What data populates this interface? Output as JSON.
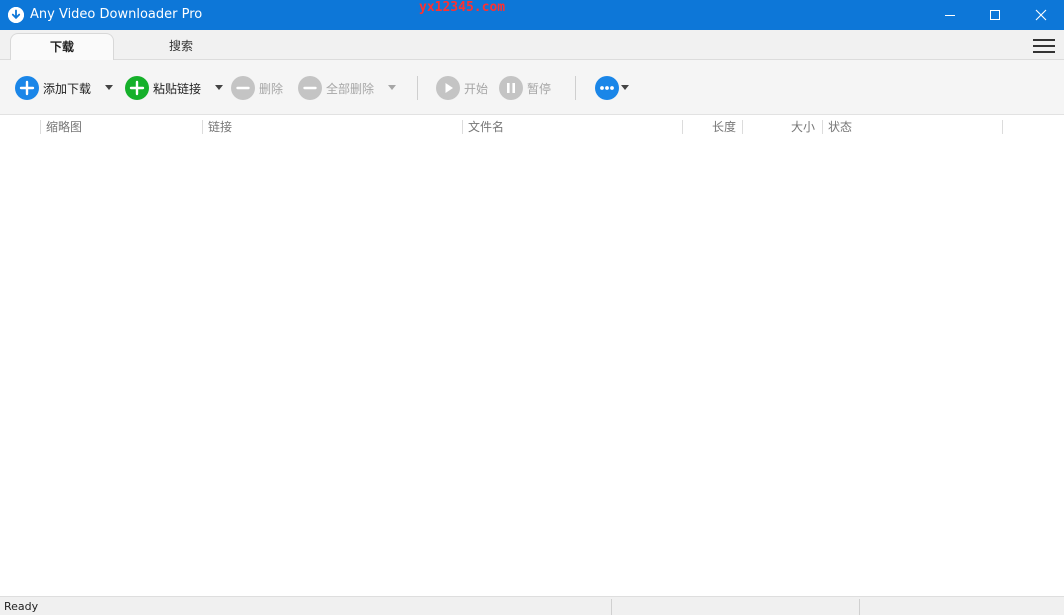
{
  "window": {
    "title": "Any Video Downloader Pro",
    "watermark": "yx12345.com"
  },
  "tabs": [
    {
      "label": "下载",
      "active": true
    },
    {
      "label": "搜索",
      "active": false
    }
  ],
  "toolbar": {
    "add_download": "添加下载",
    "paste_link": "粘贴链接",
    "delete": "删除",
    "delete_all": "全部删除",
    "start": "开始",
    "pause": "暂停"
  },
  "columns": {
    "thumbnail": "缩略图",
    "link": "链接",
    "filename": "文件名",
    "duration": "长度",
    "size": "大小",
    "status": "状态"
  },
  "status": {
    "text": "Ready"
  },
  "colors": {
    "titlebar": "#0d77d8",
    "add_button": "#1a86e8",
    "paste_button": "#15b02a",
    "disabled_button": "#c4c4c4",
    "more_button": "#1a86e8"
  }
}
